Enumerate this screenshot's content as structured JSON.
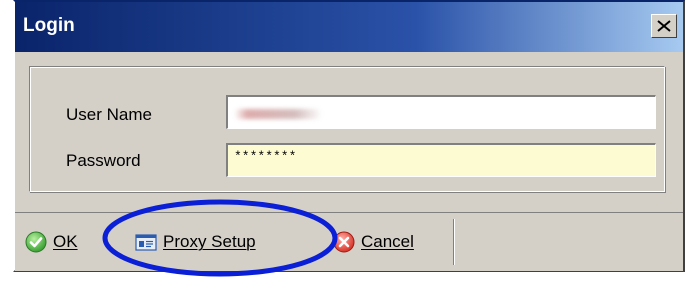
{
  "window": {
    "title": "Login",
    "close_label": "×"
  },
  "form": {
    "username_label": "User Name",
    "username_value": "",
    "password_label": "Password",
    "password_value": "********"
  },
  "buttons": {
    "ok_label": "OK",
    "proxy_label": "Proxy Setup",
    "cancel_label": "Cancel"
  },
  "icons": {
    "ok": "check-circle-icon",
    "proxy": "proxy-card-icon",
    "cancel": "cancel-circle-icon",
    "close": "close-icon"
  },
  "colors": {
    "title_gradient_start": "#0a246a",
    "title_gradient_end": "#a6caf0",
    "highlight_ellipse": "#0a1fd6",
    "password_field_bg": "#fdfbd2"
  }
}
